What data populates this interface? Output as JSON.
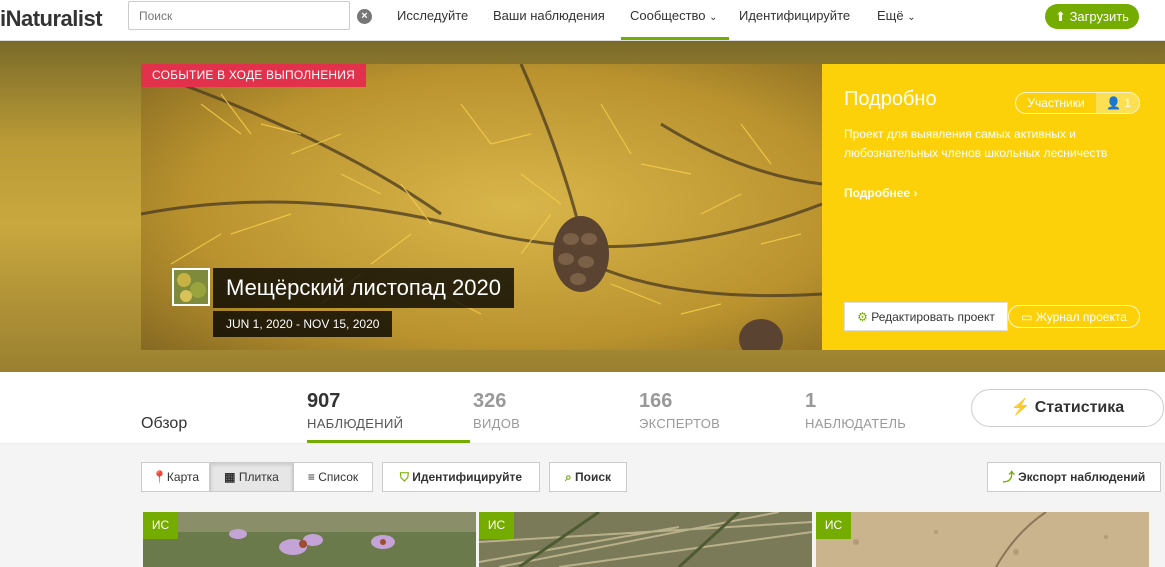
{
  "header": {
    "logo": "iNaturalist",
    "search_placeholder": "Поиск",
    "nav": [
      "Исследуйте",
      "Ваши наблюдения",
      "Сообщество",
      "Идентифицируйте",
      "Ещё"
    ],
    "upload_label": "Загрузить"
  },
  "hero": {
    "event_badge": "СОБЫТИЕ В ХОДЕ ВЫПОЛНЕНИЯ",
    "title": "Мещёрский листопад 2020",
    "dates": "JUN 1, 2020 - NOV 15, 2020"
  },
  "panel": {
    "title": "Подробно",
    "members_label": "Участники",
    "members_count": "1",
    "description": "Проект для выявления самых активных и любознательных членов школьных лесничеств",
    "more_link": "Подробнее",
    "edit_label": "Редактировать проект",
    "journal_label": "Журнал проекта"
  },
  "stats": {
    "overview": "Обзор",
    "items": [
      {
        "num": "907",
        "label": "НАБЛЮДЕНИЙ"
      },
      {
        "num": "326",
        "label": "ВИДОВ"
      },
      {
        "num": "166",
        "label": "ЭКСПЕРТОВ"
      },
      {
        "num": "1",
        "label": "НАБЛЮДАТЕЛЬ"
      }
    ],
    "statistics_label": "Статистика"
  },
  "toolbar": {
    "map": "Карта",
    "grid": "Плитка",
    "list": "Список",
    "identify": "Идентифицируйте",
    "search": "Поиск",
    "export": "Экспорт наблюдений"
  },
  "tiles": [
    {
      "badge": "ИС"
    },
    {
      "badge": "ИС"
    },
    {
      "badge": "ИС"
    }
  ],
  "colors": {
    "brand_green": "#74ac00",
    "event_red": "#e2314a",
    "panel_yellow": "#fdd10a"
  }
}
